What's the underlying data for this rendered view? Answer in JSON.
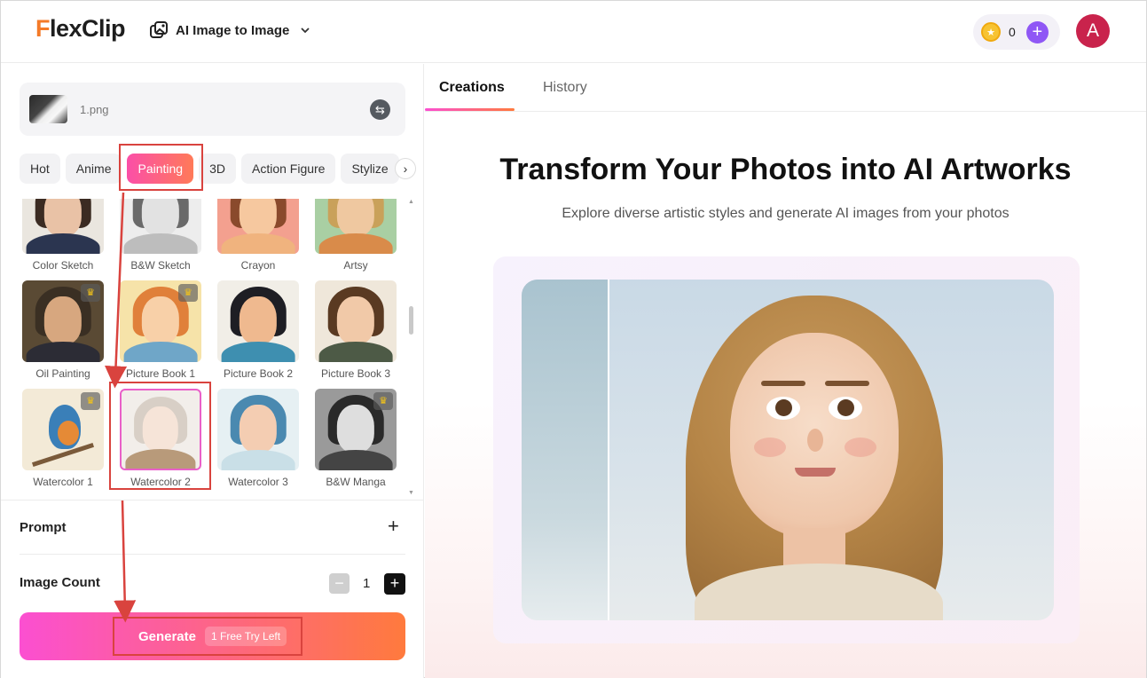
{
  "header": {
    "logo_first": "F",
    "logo_rest": "lexClip",
    "tool_name": "AI Image to Image",
    "credits": "0",
    "avatar_letter": "A"
  },
  "left": {
    "file_name": "1.png",
    "categories": [
      "Hot",
      "Anime",
      "Painting",
      "3D",
      "Action Figure",
      "Stylize"
    ],
    "active_category": "Painting",
    "styles": [
      {
        "label": "Color Sketch",
        "premium": false
      },
      {
        "label": "B&W Sketch",
        "premium": false
      },
      {
        "label": "Crayon",
        "premium": false
      },
      {
        "label": "Artsy",
        "premium": false
      },
      {
        "label": "Oil Painting",
        "premium": true
      },
      {
        "label": "Picture Book 1",
        "premium": true
      },
      {
        "label": "Picture Book 2",
        "premium": false
      },
      {
        "label": "Picture Book 3",
        "premium": false
      },
      {
        "label": "Watercolor 1",
        "premium": true
      },
      {
        "label": "Watercolor 2",
        "premium": false
      },
      {
        "label": "Watercolor 3",
        "premium": false
      },
      {
        "label": "B&W Manga",
        "premium": true
      }
    ],
    "selected_style": "Watercolor 2",
    "prompt_label": "Prompt",
    "image_count_label": "Image Count",
    "image_count": "1",
    "generate_label": "Generate",
    "generate_badge": "1 Free Try Left"
  },
  "right": {
    "tabs": [
      "Creations",
      "History"
    ],
    "active_tab": "Creations",
    "title": "Transform Your Photos into AI Artworks",
    "subtitle": "Explore diverse artistic styles and generate AI images from your photos"
  },
  "colors": {
    "accent_gradient_start": "#fb4fd1",
    "accent_gradient_end": "#ff7a3d",
    "annotation_red": "#d9433e",
    "avatar_bg": "#c9234c",
    "credit_add_bg": "#8f57f5"
  }
}
